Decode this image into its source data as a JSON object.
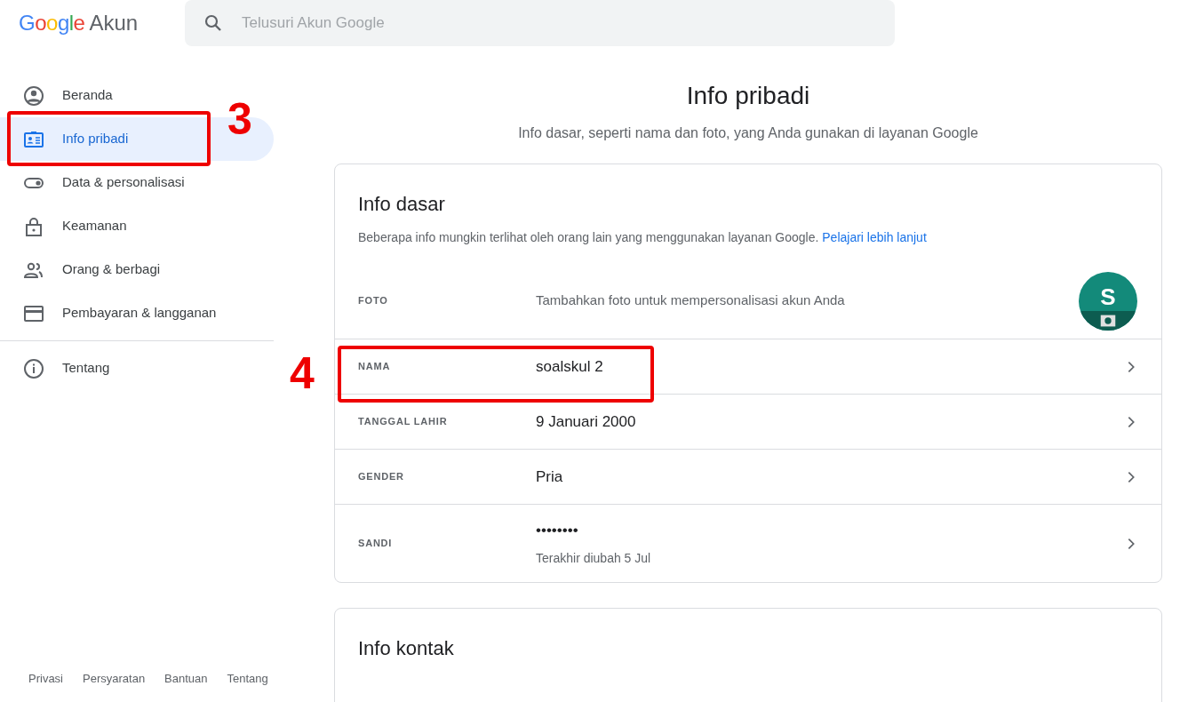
{
  "header": {
    "logo": {
      "brand": "Google",
      "product": "Akun"
    },
    "search": {
      "placeholder": "Telusuri Akun Google"
    }
  },
  "sidebar": {
    "items": [
      {
        "label": "Beranda",
        "selected": false
      },
      {
        "label": "Info pribadi",
        "selected": true
      },
      {
        "label": "Data & personalisasi",
        "selected": false
      },
      {
        "label": "Keamanan",
        "selected": false
      },
      {
        "label": "Orang & berbagi",
        "selected": false
      },
      {
        "label": "Pembayaran & langganan",
        "selected": false
      }
    ],
    "secondary_items": [
      {
        "label": "Tentang",
        "selected": false
      }
    ],
    "footer_links": [
      "Privasi",
      "Persyaratan",
      "Bantuan",
      "Tentang"
    ]
  },
  "main": {
    "title": "Info pribadi",
    "subtitle": "Info dasar, seperti nama dan foto, yang Anda gunakan di layanan Google",
    "cards": [
      {
        "title": "Info dasar",
        "description": "Beberapa info mungkin terlihat oleh orang lain yang menggunakan layanan Google.",
        "link": "Pelajari lebih lanjut",
        "rows": [
          {
            "kind": "photo",
            "label": "FOTO",
            "value": "Tambahkan foto untuk mempersonalisasi akun Anda",
            "avatar_letter": "S"
          },
          {
            "kind": "field",
            "label": "NAMA",
            "value": "soalskul 2"
          },
          {
            "kind": "field",
            "label": "TANGGAL LAHIR",
            "value": "9 Januari 2000"
          },
          {
            "kind": "field",
            "label": "GENDER",
            "value": "Pria"
          },
          {
            "kind": "field",
            "label": "SANDI",
            "value": "••••••••",
            "note": "Terakhir diubah 5 Jul"
          }
        ]
      },
      {
        "title": "Info kontak"
      }
    ]
  },
  "annotations": [
    {
      "label": "3"
    },
    {
      "label": "4"
    }
  ]
}
